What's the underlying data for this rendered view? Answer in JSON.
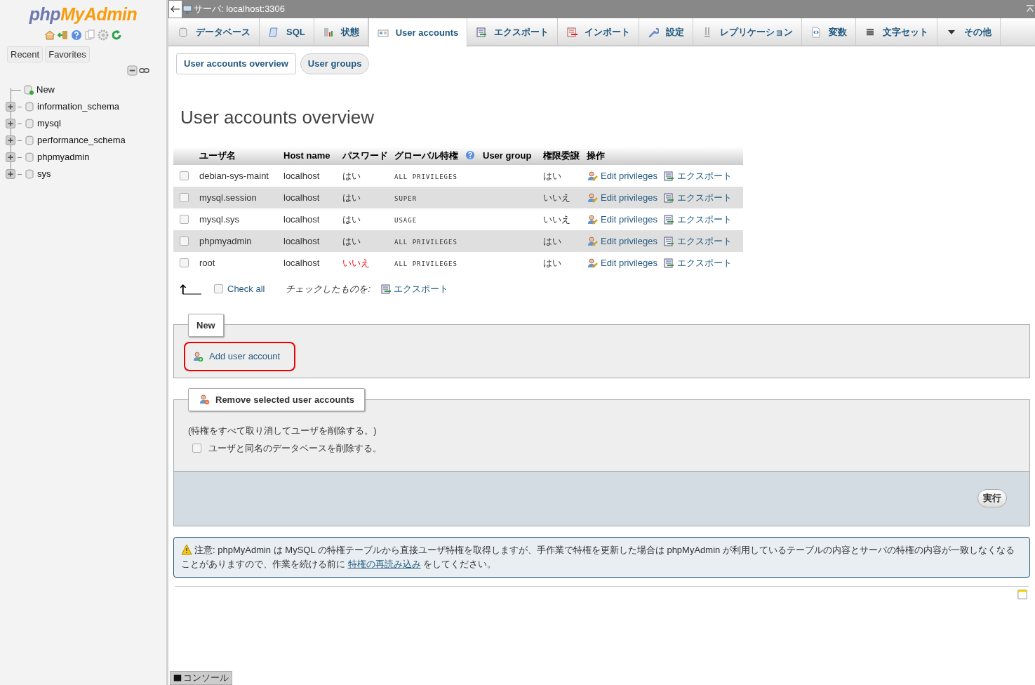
{
  "sidebar": {
    "logo": {
      "prefix": "php",
      "main": "MyAdmin"
    },
    "tabs": [
      "Recent",
      "Favorites"
    ],
    "tree": [
      {
        "label": "New",
        "kind": "new"
      },
      {
        "label": "information_schema",
        "kind": "db"
      },
      {
        "label": "mysql",
        "kind": "db"
      },
      {
        "label": "performance_schema",
        "kind": "db"
      },
      {
        "label": "phpmyadmin",
        "kind": "db"
      },
      {
        "label": "sys",
        "kind": "db"
      }
    ]
  },
  "header": {
    "title": "サーバ: localhost:3306"
  },
  "tabs": [
    {
      "label": "データベース",
      "selected": false
    },
    {
      "label": "SQL",
      "selected": false
    },
    {
      "label": "状態",
      "selected": false
    },
    {
      "label": "User accounts",
      "selected": true
    },
    {
      "label": "エクスポート",
      "selected": false
    },
    {
      "label": "インポート",
      "selected": false
    },
    {
      "label": "設定",
      "selected": false
    },
    {
      "label": "レプリケーション",
      "selected": false
    },
    {
      "label": "変数",
      "selected": false
    },
    {
      "label": "文字セット",
      "selected": false
    },
    {
      "label": "その他",
      "selected": false
    }
  ],
  "subtabs": [
    {
      "label": "User accounts overview",
      "selected": true
    },
    {
      "label": "User groups",
      "selected": false
    }
  ],
  "heading": "User accounts overview",
  "table": {
    "columns": [
      "ユーザ名",
      "Host name",
      "パスワード",
      "グローバル特権",
      "User group",
      "権限委譲",
      "操作"
    ],
    "rows": [
      {
        "checked": false,
        "user": "debian-sys-maint",
        "host": "localhost",
        "password": "はい",
        "password_set": true,
        "privileges": "ALL PRIVILEGES",
        "grant": "はい",
        "actions": [
          "Edit privileges",
          "エクスポート"
        ]
      },
      {
        "checked": false,
        "user": "mysql.session",
        "host": "localhost",
        "password": "はい",
        "password_set": true,
        "privileges": "SUPER",
        "grant": "いいえ",
        "actions": [
          "Edit privileges",
          "エクスポート"
        ]
      },
      {
        "checked": false,
        "user": "mysql.sys",
        "host": "localhost",
        "password": "はい",
        "password_set": true,
        "privileges": "USAGE",
        "grant": "いいえ",
        "actions": [
          "Edit privileges",
          "エクスポート"
        ]
      },
      {
        "checked": false,
        "user": "phpmyadmin",
        "host": "localhost",
        "password": "はい",
        "password_set": true,
        "privileges": "ALL PRIVILEGES",
        "grant": "はい",
        "actions": [
          "Edit privileges",
          "エクスポート"
        ]
      },
      {
        "checked": false,
        "user": "root",
        "host": "localhost",
        "password": "いいえ",
        "password_set": false,
        "privileges": "ALL PRIVILEGES",
        "grant": "はい",
        "actions": [
          "Edit privileges",
          "エクスポート"
        ]
      }
    ]
  },
  "bulk": {
    "check_all": {
      "label": "Check all",
      "checked": false
    },
    "with_selected": "チェックしたものを:",
    "export": "エクスポート"
  },
  "new_section": {
    "legend": "New",
    "button": "Add user account",
    "highlighted": true
  },
  "remove_section": {
    "legend": "Remove selected user accounts",
    "note": "(特権をすべて取り消してユーザを削除する。)",
    "drop_db": {
      "label": "ユーザと同名のデータベースを削除する。",
      "checked": false
    },
    "submit": "実行"
  },
  "notice": {
    "before": "注意: phpMyAdmin は MySQL の特権テーブルから直接ユーザ特権を取得しますが、手作業で特権を更新した場合は phpMyAdmin が利用しているテーブルの内容とサーバの特権の内容が一致しなくなることがありますので、作業を続ける前に ",
    "link": "特権の再読み込み",
    "after": " をしてください。"
  },
  "console": "コンソール"
}
